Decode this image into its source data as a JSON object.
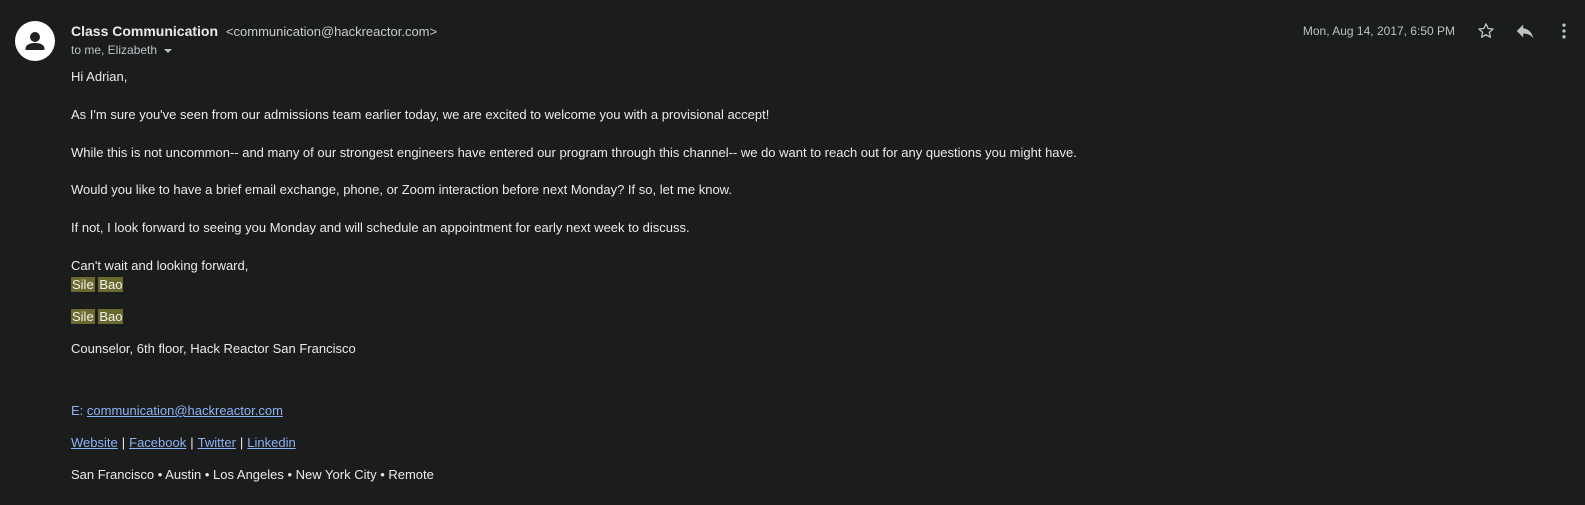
{
  "header": {
    "sender_name": "Class Communication",
    "sender_email": "<communication@hackreactor.com>",
    "recipients": "to me, Elizabeth",
    "date": "Mon, Aug 14, 2017, 6:50 PM",
    "icons": {
      "avatar": "person-avatar-icon",
      "star": "star-icon",
      "reply": "reply-icon",
      "more": "more-vert-icon"
    }
  },
  "body": {
    "greeting": "Hi Adrian,",
    "paragraphs": [
      "As I'm sure you've seen from our admissions team earlier today, we are excited to welcome you with a provisional accept!",
      "While this is not uncommon-- and many of our strongest engineers have entered our program through this channel-- we do want to reach out for any questions you might have.",
      "Would you like to have a brief email exchange, phone, or Zoom interaction before next Monday? If so, let me know.",
      "If not, I look forward to seeing you Monday and will schedule an appointment for early next week to discuss."
    ],
    "closing": "Can't wait and looking forward,"
  },
  "signature": {
    "first_name": "Sile",
    "last_name": "Bao",
    "title": "Counselor, 6th floor, Hack Reactor San Francisco",
    "email_label": "E: ",
    "email": "communication@hackreactor.com",
    "links": [
      "Website",
      "Facebook",
      "Twitter",
      "Linkedin"
    ],
    "separator": "|",
    "locations": "San Francisco • Austin • Los Angeles • New York City • Remote"
  },
  "colors": {
    "background": "#1b1c1c",
    "text": "#e8eaed",
    "link": "#8ab4f8",
    "highlight": "#6b6a2e"
  }
}
